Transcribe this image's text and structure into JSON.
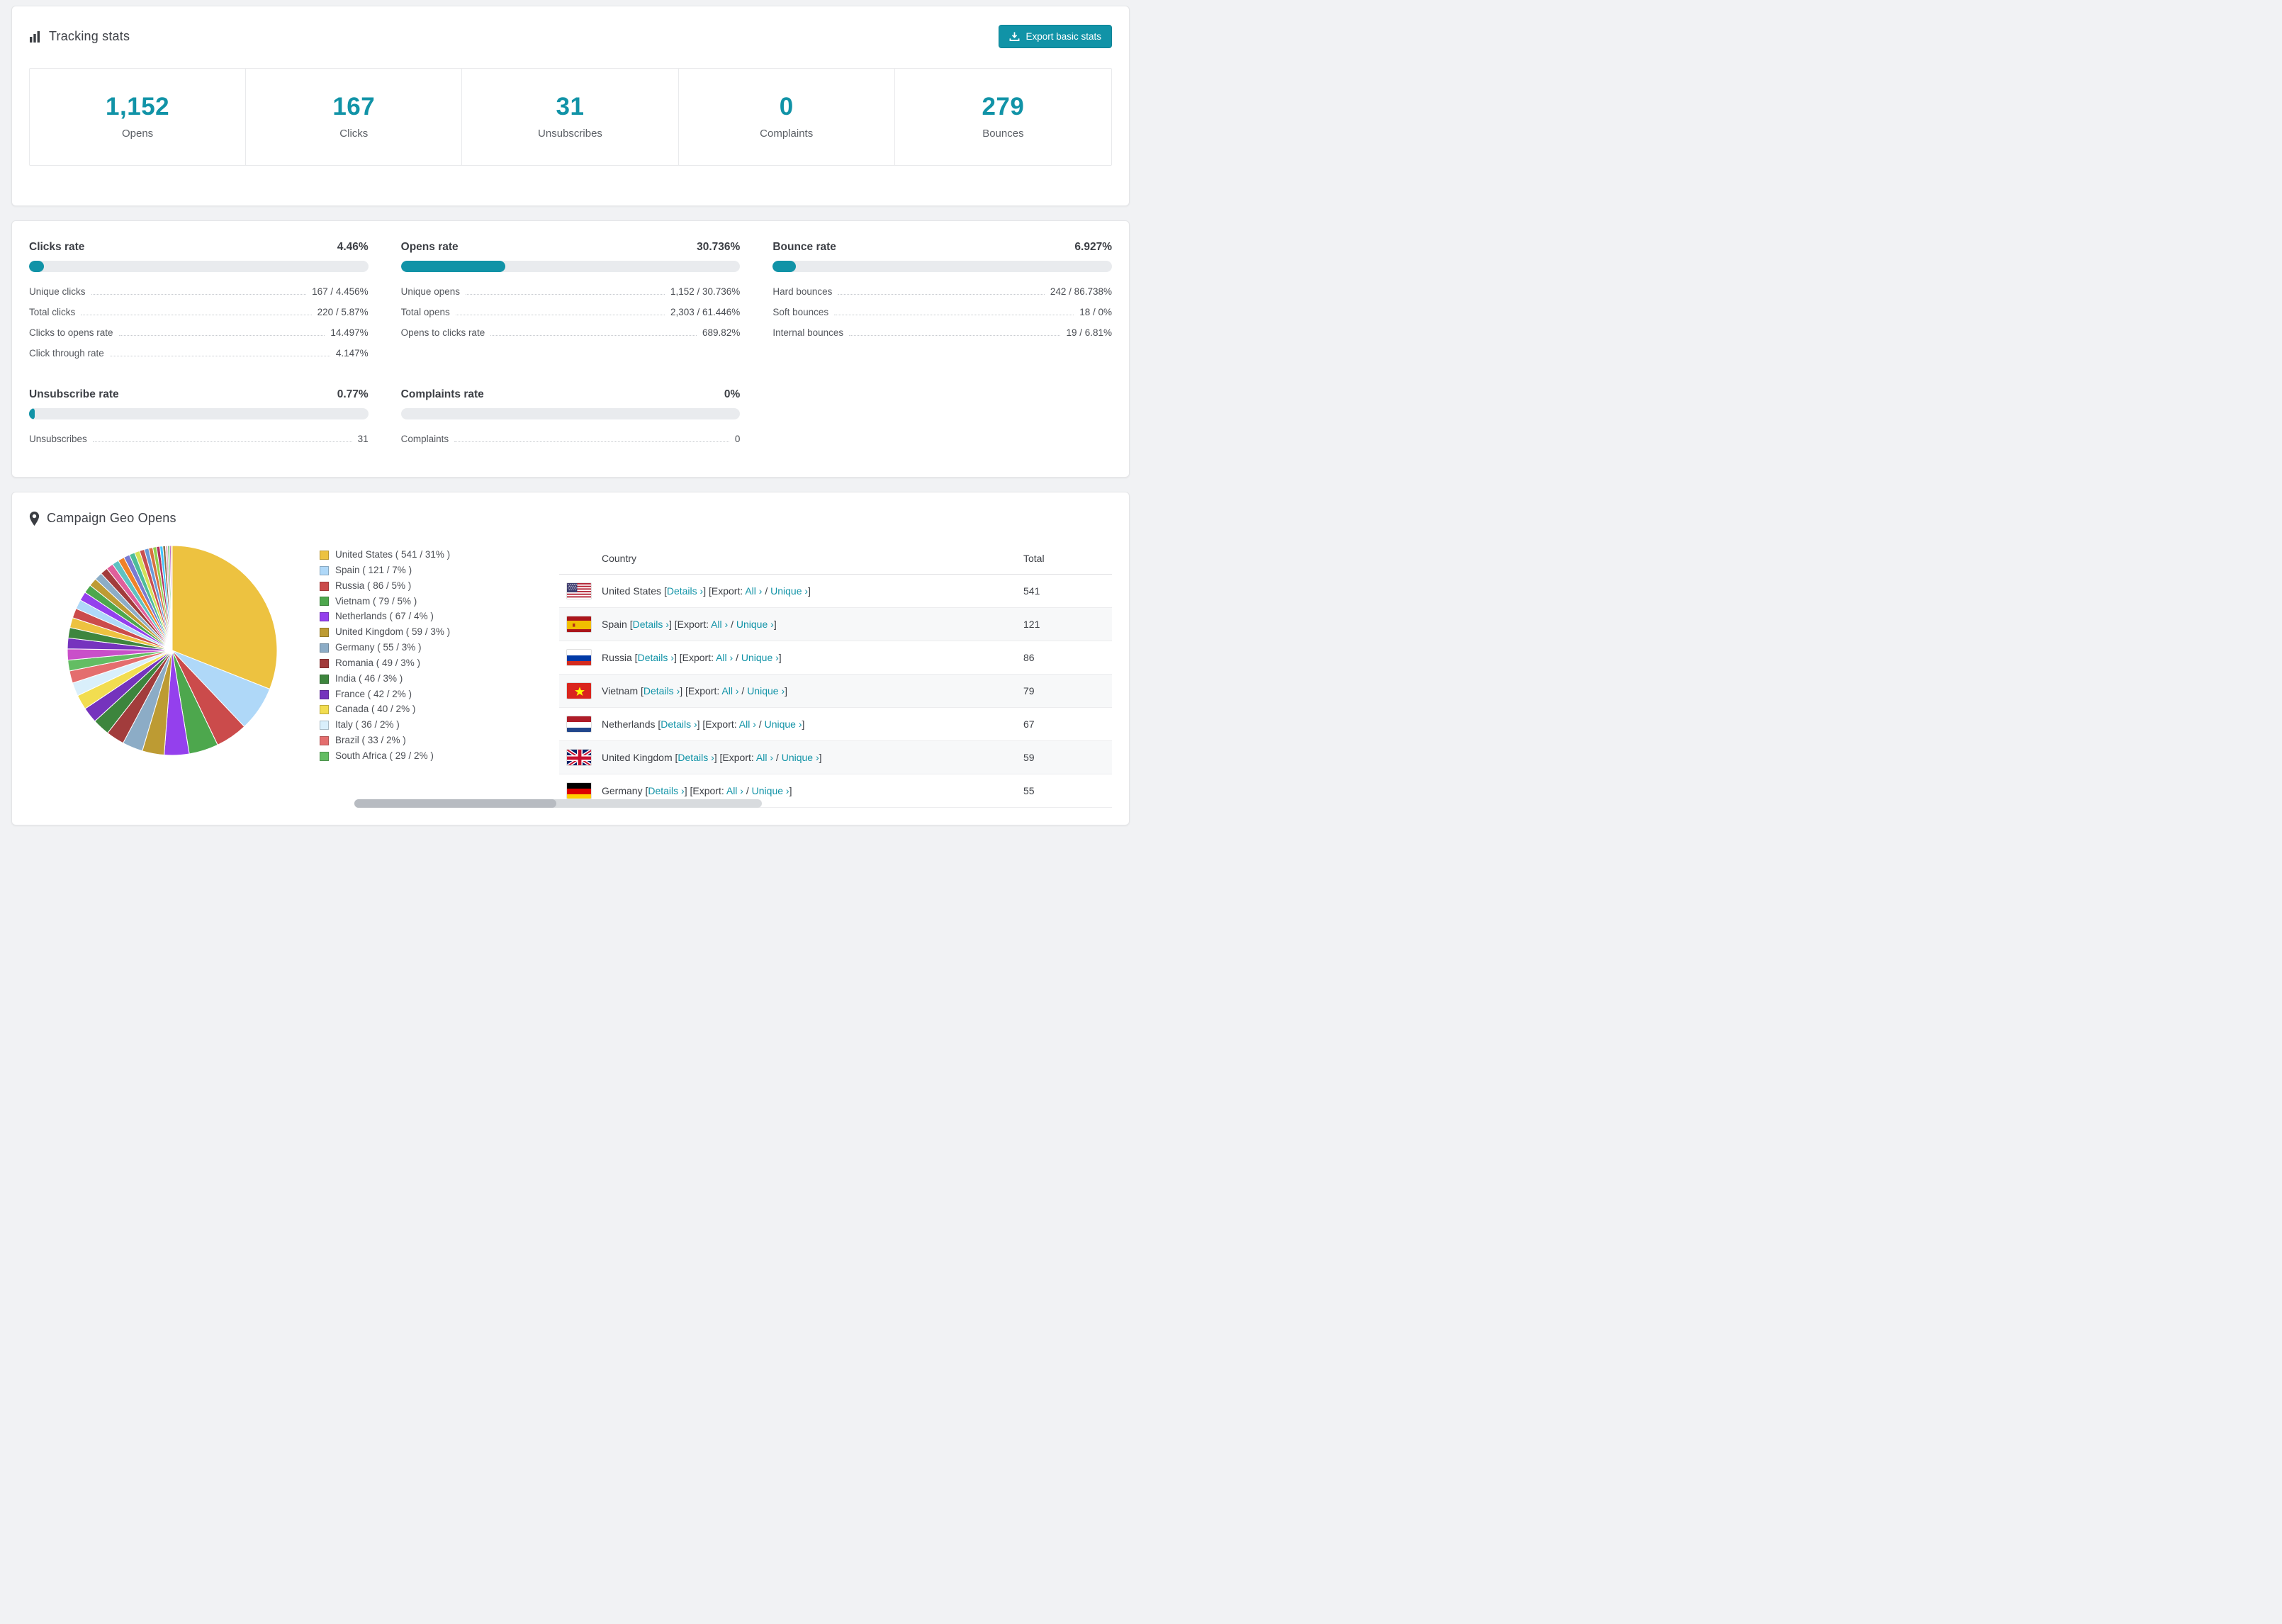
{
  "colors": {
    "accent": "#1193a7"
  },
  "tracking": {
    "title": "Tracking stats",
    "export_button": "Export basic stats",
    "stats": [
      {
        "value": "1,152",
        "label": "Opens"
      },
      {
        "value": "167",
        "label": "Clicks"
      },
      {
        "value": "31",
        "label": "Unsubscribes"
      },
      {
        "value": "0",
        "label": "Complaints"
      },
      {
        "value": "279",
        "label": "Bounces"
      }
    ]
  },
  "rates": [
    {
      "title": "Clicks rate",
      "percent_label": "4.46%",
      "bar_percent": 4.46,
      "rows": [
        {
          "label": "Unique clicks",
          "value": "167 / 4.456%"
        },
        {
          "label": "Total clicks",
          "value": "220 / 5.87%"
        },
        {
          "label": "Clicks to opens rate",
          "value": "14.497%"
        },
        {
          "label": "Click through rate",
          "value": "4.147%"
        }
      ]
    },
    {
      "title": "Opens rate",
      "percent_label": "30.736%",
      "bar_percent": 30.736,
      "rows": [
        {
          "label": "Unique opens",
          "value": "1,152 / 30.736%"
        },
        {
          "label": "Total opens",
          "value": "2,303 / 61.446%"
        },
        {
          "label": "Opens to clicks rate",
          "value": "689.82%"
        }
      ]
    },
    {
      "title": "Bounce rate",
      "percent_label": "6.927%",
      "bar_percent": 6.927,
      "rows": [
        {
          "label": "Hard bounces",
          "value": "242 / 86.738%"
        },
        {
          "label": "Soft bounces",
          "value": "18 / 0%"
        },
        {
          "label": "Internal bounces",
          "value": "19 / 6.81%"
        }
      ]
    },
    {
      "title": "Unsubscribe rate",
      "percent_label": "0.77%",
      "bar_percent": 0.77,
      "rows": [
        {
          "label": "Unsubscribes",
          "value": "31"
        }
      ]
    },
    {
      "title": "Complaints rate",
      "percent_label": "0%",
      "bar_percent": 0,
      "rows": [
        {
          "label": "Complaints",
          "value": "0"
        }
      ]
    }
  ],
  "geo": {
    "title": "Campaign Geo Opens",
    "table": {
      "country_header": "Country",
      "total_header": "Total",
      "details_label": "Details ›",
      "export_label": "Export:",
      "all_label": "All ›",
      "unique_label": "Unique ›",
      "format": {
        "open": "[",
        "close": "]",
        "slash": "/"
      },
      "rows": [
        {
          "country": "United States",
          "flag": "us",
          "total": "541"
        },
        {
          "country": "Spain",
          "flag": "es",
          "total": "121"
        },
        {
          "country": "Russia",
          "flag": "ru",
          "total": "86"
        },
        {
          "country": "Vietnam",
          "flag": "vn",
          "total": "79"
        },
        {
          "country": "Netherlands",
          "flag": "nl",
          "total": "67"
        },
        {
          "country": "United Kingdom",
          "flag": "gb",
          "total": "59"
        },
        {
          "country": "Germany",
          "flag": "de",
          "total": "55"
        }
      ]
    }
  },
  "chart_data": {
    "type": "pie",
    "title": "Campaign Geo Opens",
    "legend_position": "right",
    "slices": [
      {
        "label": "United States",
        "value": 541,
        "percent": 31,
        "color": "#edc240"
      },
      {
        "label": "Spain",
        "value": 121,
        "percent": 7,
        "color": "#afd8f8"
      },
      {
        "label": "Russia",
        "value": 86,
        "percent": 5,
        "color": "#cb4b4b"
      },
      {
        "label": "Vietnam",
        "value": 79,
        "percent": 5,
        "color": "#4da74d"
      },
      {
        "label": "Netherlands",
        "value": 67,
        "percent": 4,
        "color": "#9440ed"
      },
      {
        "label": "United Kingdom",
        "value": 59,
        "percent": 3,
        "color": "#bd9b33"
      },
      {
        "label": "Germany",
        "value": 55,
        "percent": 3,
        "color": "#8cacc6"
      },
      {
        "label": "Romania",
        "value": 49,
        "percent": 3,
        "color": "#a23c3c"
      },
      {
        "label": "India",
        "value": 46,
        "percent": 3,
        "color": "#3d853d"
      },
      {
        "label": "France",
        "value": 42,
        "percent": 2,
        "color": "#7533bd"
      },
      {
        "label": "Canada",
        "value": 40,
        "percent": 2,
        "color": "#f2dd50"
      },
      {
        "label": "Italy",
        "value": 36,
        "percent": 2,
        "color": "#d9effb"
      },
      {
        "label": "Brazil",
        "value": 33,
        "percent": 2,
        "color": "#e46e6e"
      },
      {
        "label": "South Africa",
        "value": 29,
        "percent": 2,
        "color": "#63bd63"
      }
    ],
    "other_slices_values": [
      30,
      29,
      28,
      27,
      26,
      25,
      24,
      23,
      22,
      21,
      20,
      19,
      18,
      17,
      16,
      15,
      14,
      13,
      12,
      11,
      10,
      9,
      8,
      7,
      6,
      5,
      4,
      3
    ],
    "other_slices_colors": [
      "#c94fc9",
      "#7633be",
      "#3e863e",
      "#edc240",
      "#cb4b4b",
      "#afd8f8",
      "#9440ed",
      "#4da74d",
      "#be9b33",
      "#8cadc6",
      "#a23c3c",
      "#e05f9b",
      "#5fc2c2",
      "#f08228",
      "#7a7ad1",
      "#4dbd9a",
      "#d4e157",
      "#c94f4f",
      "#6a9bd8",
      "#d8713f",
      "#8fd14f",
      "#b03060",
      "#40c4ff",
      "#8b6f47",
      "#e6b3cc",
      "#66bb6a",
      "#ba68c8",
      "#ffa726"
    ]
  }
}
